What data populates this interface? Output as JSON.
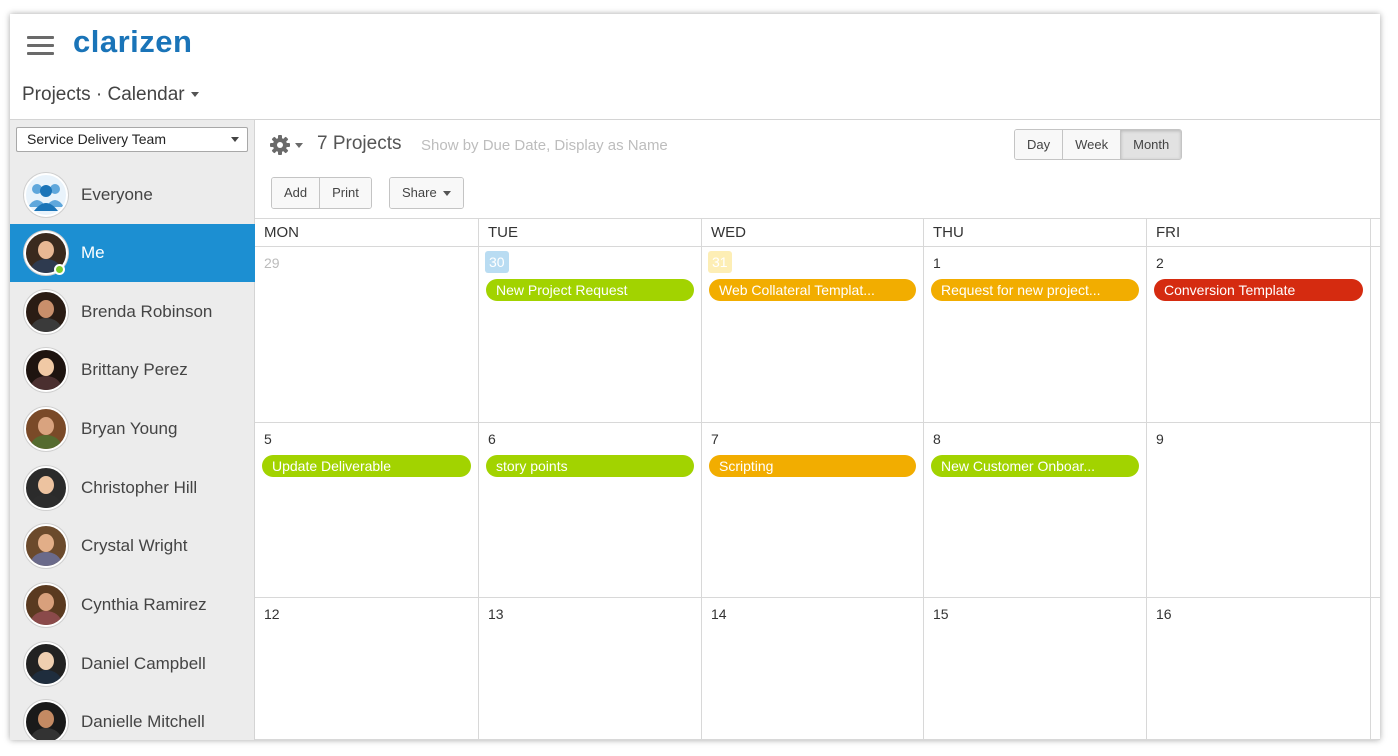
{
  "app": {
    "logo": "clarizen"
  },
  "header": {
    "breadcrumb": "Projects · Calendar"
  },
  "sidebar": {
    "team_select": "Service Delivery Team",
    "people": [
      {
        "name": "Everyone",
        "icon": "group-icon"
      },
      {
        "name": "Me",
        "active": true,
        "online": true
      },
      {
        "name": "Brenda Robinson"
      },
      {
        "name": "Brittany Perez"
      },
      {
        "name": "Bryan Young"
      },
      {
        "name": "Christopher Hill"
      },
      {
        "name": "Crystal Wright"
      },
      {
        "name": "Cynthia Ramirez"
      },
      {
        "name": "Daniel Campbell"
      },
      {
        "name": "Danielle Mitchell"
      }
    ]
  },
  "toolbar": {
    "project_count": "7 Projects",
    "subtitle": "Show by Due Date, Display as Name",
    "views": [
      "Day",
      "Week",
      "Month"
    ],
    "active_view": "Month",
    "add_label": "Add",
    "print_label": "Print",
    "share_label": "Share"
  },
  "calendar": {
    "days_of_week": [
      "MON",
      "TUE",
      "WED",
      "THU",
      "FRI"
    ],
    "weeks": [
      [
        {
          "num": "29",
          "muted": true
        },
        {
          "num": "30",
          "badge": "#b9dcf2",
          "events": [
            {
              "label": "New Project Request",
              "color": "#a2d300"
            }
          ]
        },
        {
          "num": "31",
          "badge": "#fdeeb5",
          "events": [
            {
              "label": "Web Collateral Templat...",
              "color": "#f2ad00"
            }
          ]
        },
        {
          "num": "1",
          "events": [
            {
              "label": "Request for new project...",
              "color": "#f2ad00"
            }
          ]
        },
        {
          "num": "2",
          "events": [
            {
              "label": "Conversion Template",
              "color": "#d52b10"
            }
          ]
        }
      ],
      [
        {
          "num": "5",
          "events": [
            {
              "label": "Update Deliverable",
              "color": "#a2d300"
            }
          ]
        },
        {
          "num": "6",
          "events": [
            {
              "label": "story points",
              "color": "#a2d300"
            }
          ]
        },
        {
          "num": "7",
          "events": [
            {
              "label": "Scripting",
              "color": "#f2ad00"
            }
          ]
        },
        {
          "num": "8",
          "events": [
            {
              "label": "New Customer Onboar...",
              "color": "#a2d300"
            }
          ]
        },
        {
          "num": "9"
        }
      ],
      [
        {
          "num": "12"
        },
        {
          "num": "13"
        },
        {
          "num": "14"
        },
        {
          "num": "15"
        },
        {
          "num": "16"
        }
      ]
    ]
  },
  "colors": {
    "accent": "#1c8fd2",
    "brand": "#1a74b8",
    "green": "#a2d300",
    "orange": "#f2ad00",
    "red": "#d52b10"
  }
}
